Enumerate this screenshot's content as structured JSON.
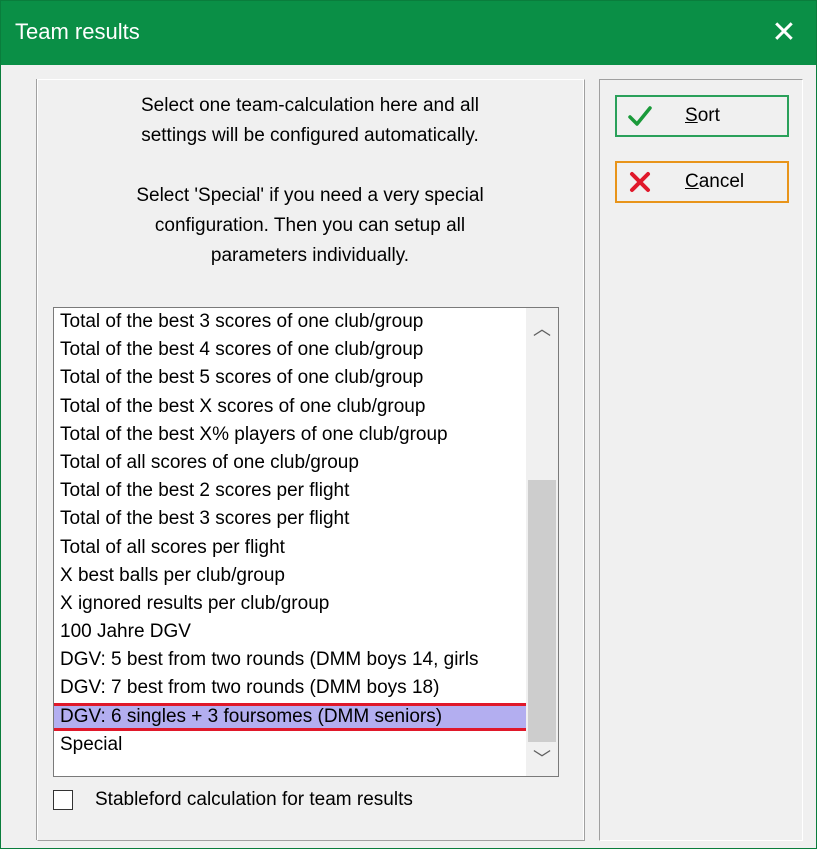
{
  "window": {
    "title": "Team results",
    "close_glyph": "✕"
  },
  "info": {
    "line1": "Select one team-calculation here and all",
    "line2": "settings will be configured automatically.",
    "line3": "Select 'Special' if you need a very special",
    "line4": "configuration. Then you can setup all",
    "line5": "parameters individually."
  },
  "list": {
    "items": [
      "Total of the best 3 scores of one club/group",
      "Total of the best 4 scores of one club/group",
      "Total of the best 5 scores of one club/group",
      "Total of the best X scores of one club/group",
      "Total of the best X% players of one club/group",
      "Total of all scores of one club/group",
      "Total of the best 2 scores per flight",
      "Total of the best 3 scores per flight",
      "Total of all scores per flight",
      "X best balls per club/group",
      "X ignored results per club/group",
      "100 Jahre DGV",
      "DGV: 5 best from two rounds (DMM boys 14, girls",
      "DGV: 7 best from two rounds (DMM boys 18)",
      "DGV: 6 singles + 3 foursomes (DMM seniors)",
      "Special"
    ],
    "selected": "DGV: 6 singles + 3 foursomes (DMM seniors)",
    "scroll_up_glyph": "︿",
    "scroll_down_glyph": "﹀"
  },
  "checkbox": {
    "label": "Stableford calculation for team results",
    "checked": false
  },
  "buttons": {
    "sort": {
      "mnemonic": "S",
      "rest": "ort",
      "icon": "check-icon",
      "color": "#2aa05a"
    },
    "cancel": {
      "mnemonic": "C",
      "rest": "ancel",
      "icon": "cross-icon",
      "color": "#e8941a"
    }
  },
  "colors": {
    "titlebar": "#0a8f46",
    "selection": "#b3aef0",
    "highlight_border": "#e0182a"
  }
}
